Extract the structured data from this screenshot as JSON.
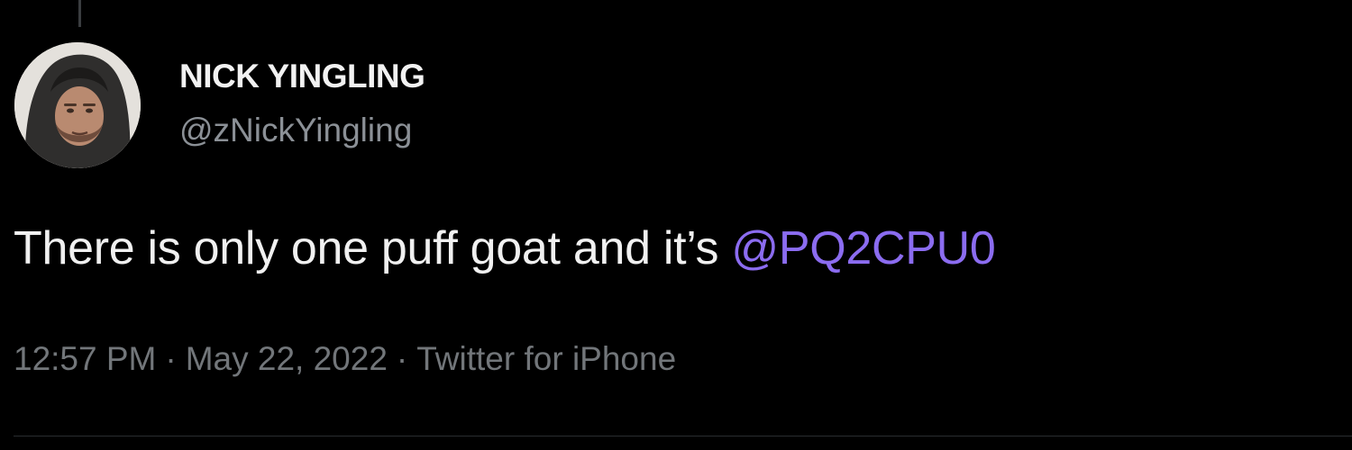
{
  "tweet": {
    "author": {
      "display_name": "NICK YINGLING",
      "handle": "@zNickYingling",
      "avatar_icon": "profile-photo"
    },
    "text": "There is only one puff goat and it’s ",
    "mention": "@PQ2CPU0",
    "meta": {
      "time": "12:57 PM",
      "separator": "·",
      "date": "May 22, 2022",
      "source": "Twitter for iPhone"
    }
  },
  "colors": {
    "background": "#000000",
    "mention": "#8b6cf0",
    "secondary_text": "#72767a"
  }
}
